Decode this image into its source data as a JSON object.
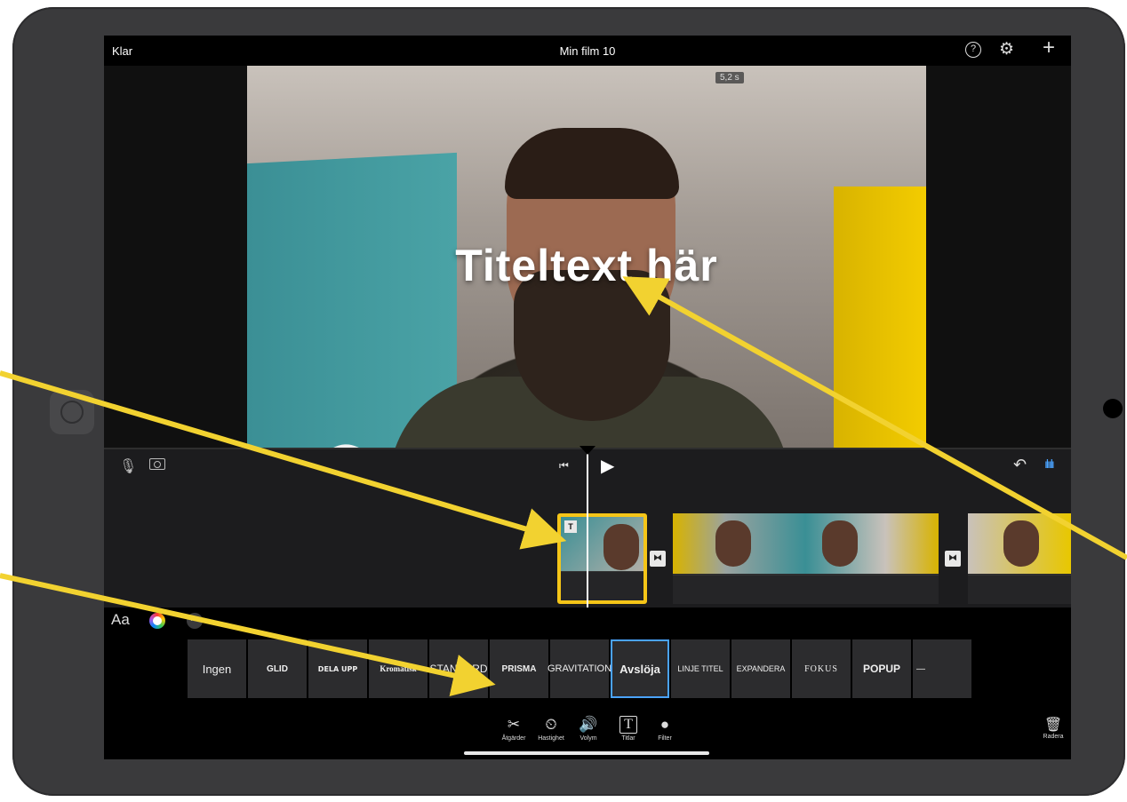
{
  "topbar": {
    "done": "Klar",
    "project_title": "Min film 10",
    "help": "?",
    "settings": "⚙",
    "add": "+"
  },
  "viewer": {
    "duration": "5,2 s",
    "zoom": "⊕",
    "title_text": "Titeltext här"
  },
  "controls": {
    "mic": "🎙",
    "skip_back": "⏮",
    "play": "▶",
    "undo": "↶",
    "waveform": "ılıılı"
  },
  "timeline": {
    "title_badge": "T",
    "transition_symbol": "⧓"
  },
  "style_row": {
    "font_label": "Aa",
    "more": "···"
  },
  "title_styles": [
    "Ingen",
    "GLID",
    "DELA UPP",
    "Kromatisk",
    "STANDARD",
    "PRISMA",
    "GRAVITATION",
    "Avslöja",
    "LINJE TITEL",
    "EXPANDERA",
    "FOKUS",
    "POPUP",
    "—"
  ],
  "selected_title_style": "Avslöja",
  "toolbar": {
    "actions_label": "Åtgärder",
    "actions_icon": "✂",
    "speed_label": "Hastighet",
    "speed_icon": "⏲",
    "volume_label": "Volym",
    "volume_icon": "🔊",
    "titles_label": "Titlar",
    "titles_icon": "T",
    "filter_label": "Filter",
    "filter_icon": "●",
    "delete_label": "Radera",
    "delete_icon": "🗑"
  },
  "colors": {
    "accent": "#4aa3ff",
    "selection": "#f5c518",
    "annotation_arrow": "#f2d230"
  }
}
